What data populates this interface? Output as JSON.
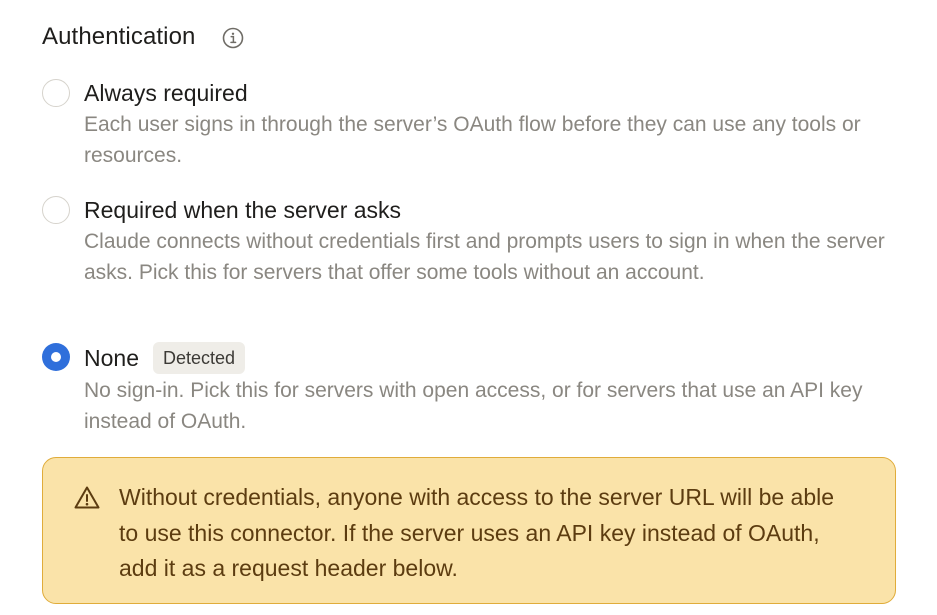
{
  "section": {
    "title": "Authentication",
    "info_icon": "info-icon"
  },
  "options": [
    {
      "label": "Always required",
      "description": "Each user signs in through the server’s OAuth flow before they can use any tools or resources.",
      "selected": false
    },
    {
      "label": "Required when the server asks",
      "description": "Claude connects without credentials first and prompts users to sign in when the server asks. Pick this for servers that offer some tools without an account.",
      "selected": false
    },
    {
      "label": "None",
      "badge": "Detected",
      "description": "No sign-in. Pick this for servers with open access, or for servers that use an API key instead of OAuth.",
      "selected": true
    }
  ],
  "warning": {
    "icon": "warning-triangle-icon",
    "text": "Without credentials, anyone with access to the server URL will be able to use this connector. If the server uses an API key instead of OAuth, add it as a request header below."
  },
  "colors": {
    "accent": "#2f6fdb",
    "warning_bg": "#fae3a9",
    "warning_border": "#e0ac3a",
    "warning_text": "#5c3c10",
    "muted_text": "#8a8781"
  }
}
